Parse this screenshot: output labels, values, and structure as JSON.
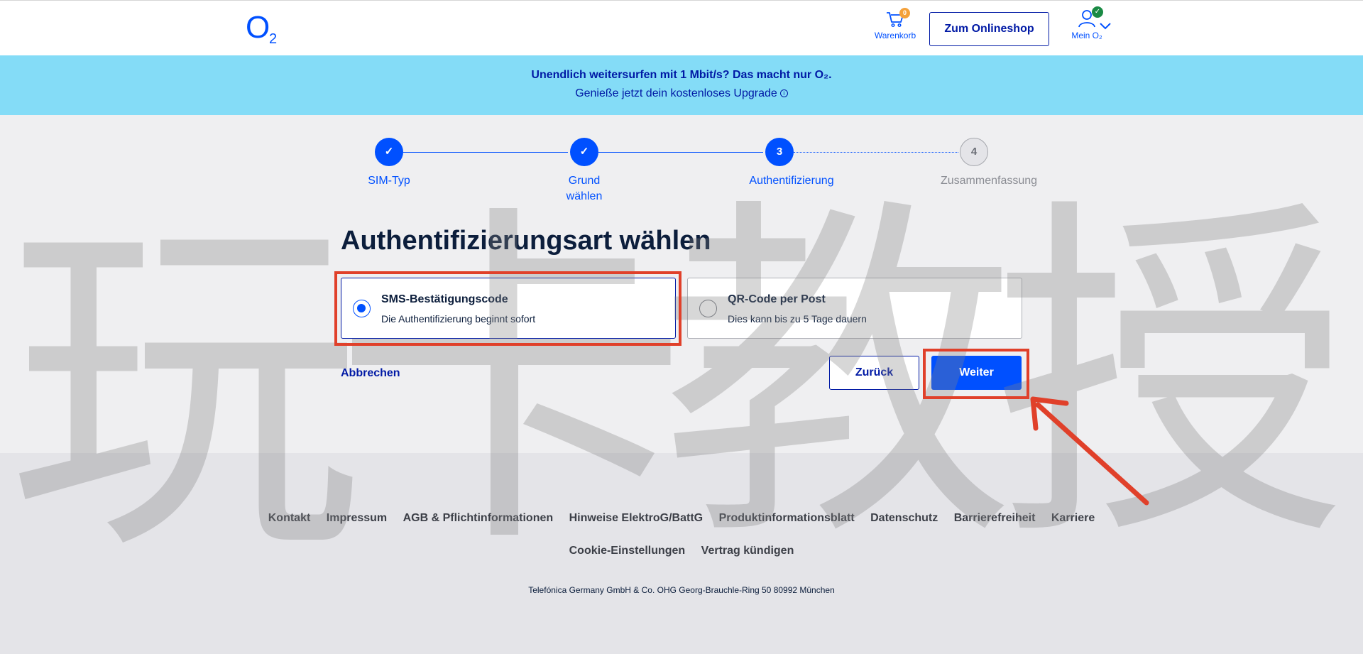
{
  "header": {
    "logo_text": "O2",
    "cart_label": "Warenkorb",
    "cart_count": "0",
    "shop_button": "Zum Onlineshop",
    "account_label": "Mein O₂",
    "account_check": "✓"
  },
  "banner": {
    "line1": "Unendlich weitersurfen mit 1 Mbit/s? Das macht nur O₂.",
    "line2": "Genieße jetzt dein kostenloses Upgrade",
    "info_symbol": "i"
  },
  "stepper": {
    "steps": [
      {
        "label": "SIM-Typ",
        "state": "done",
        "symbol": "✓"
      },
      {
        "label": "Grund wählen",
        "state": "done",
        "symbol": "✓"
      },
      {
        "label": "Authentifizierung",
        "state": "current",
        "symbol": "3"
      },
      {
        "label": "Zusammenfassung",
        "state": "upcoming",
        "symbol": "4"
      }
    ]
  },
  "main": {
    "title": "Authentifizierungsart wählen",
    "options": [
      {
        "title": "SMS-Bestätigungscode",
        "subtitle": "Die Authentifizierung beginnt sofort",
        "selected": true
      },
      {
        "title": "QR-Code per Post",
        "subtitle": "Dies kann bis zu 5 Tage dauern",
        "selected": false
      }
    ],
    "cancel_link": "Abbrechen",
    "back_button": "Zurück",
    "next_button": "Weiter"
  },
  "footer": {
    "links_row1": [
      "Kontakt",
      "Impressum",
      "AGB & Pflichtinformationen",
      "Hinweise ElektroG/BattG",
      "Produktinformationsblatt",
      "Datenschutz",
      "Barrierefreiheit",
      "Karriere"
    ],
    "links_row2": [
      "Cookie-Einstellungen",
      "Vertrag kündigen"
    ],
    "copyright": "Telefónica Germany GmbH & Co. OHG Georg-Brauchle-Ring 50 80992 München"
  },
  "watermark": {
    "chars": [
      "玩",
      "卡",
      "教",
      "授"
    ]
  },
  "colors": {
    "brand_blue": "#0050ff",
    "dark_blue": "#0019a5",
    "banner_bg": "#84dcf7",
    "highlight_red": "#e0402a"
  }
}
